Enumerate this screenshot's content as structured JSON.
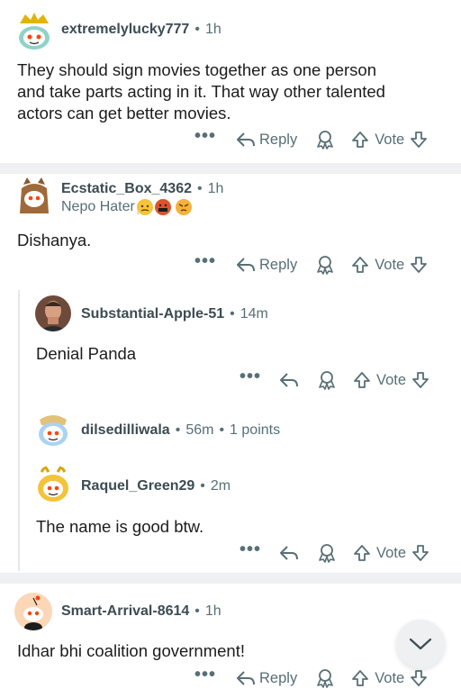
{
  "comments": [
    {
      "username": "extremelylucky777",
      "age": "1h",
      "body_lines": [
        "They should sign movies together as one person",
        "and take parts acting in it. That way other talented",
        "actors can get better movies."
      ],
      "reply_label": "Reply",
      "vote_label": "Vote"
    },
    {
      "username": "Ecstatic_Box_4362",
      "age": "1h",
      "flair": "Nepo Hater",
      "body": "Dishanya.",
      "reply_label": "Reply",
      "vote_label": "Vote"
    },
    {
      "username": "Substantial-Apple-51",
      "age": "14m",
      "body": "Denial Panda",
      "vote_label": "Vote"
    },
    {
      "username": "dilsedilliwala",
      "age": "56m",
      "points": "1 points"
    },
    {
      "username": "Raquel_Green29",
      "age": "2m",
      "body": "The name is good btw.",
      "vote_label": "Vote"
    },
    {
      "username": "Smart-Arrival-8614",
      "age": "1h",
      "body": "Idhar bhi coalition government!",
      "reply_label": "Reply",
      "vote_label": "Vote"
    }
  ],
  "separator": "•",
  "more_glyph": "•••",
  "icons": {
    "reply": "reply-arrow-icon",
    "award": "award-icon",
    "upvote": "upvote-arrow-icon",
    "downvote": "downvote-arrow-icon",
    "collapse": "chevron-down-icon"
  },
  "colors": {
    "meta": "#576f76",
    "divider": "#eef0f2",
    "text": "#1c1c1c"
  }
}
